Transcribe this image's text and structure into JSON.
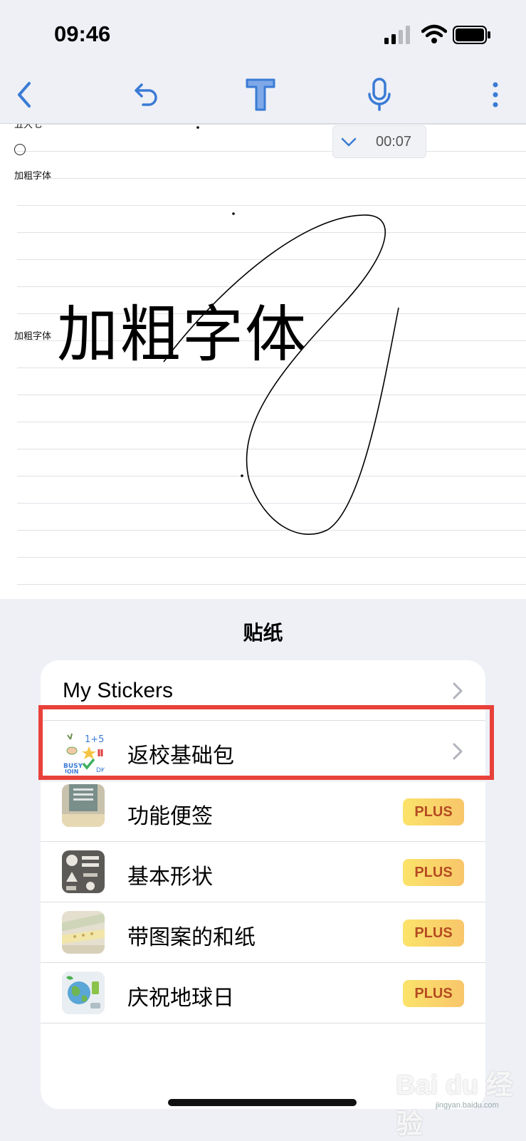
{
  "status_bar": {
    "time": "09:46"
  },
  "note": {
    "cut_top_text": "五大七",
    "small_label_1": "加粗字体",
    "small_label_2": "加粗字体",
    "big_text": "加粗字体",
    "recording_time": "00:07"
  },
  "sticker_sheet": {
    "title": "贴纸",
    "items": [
      {
        "label": "My Stickers",
        "icon": "chevron-right-icon"
      },
      {
        "label": "返校基础包",
        "icon": "chevron-right-icon",
        "thumbnail": "back-to-school-stickers-icon"
      },
      {
        "label": "功能便签",
        "badge": "PLUS",
        "thumbnail": "functional-notes-icon"
      },
      {
        "label": "基本形状",
        "badge": "PLUS",
        "thumbnail": "basic-shapes-icon"
      },
      {
        "label": "带图案的和纸",
        "badge": "PLUS",
        "thumbnail": "patterned-washi-icon"
      },
      {
        "label": "庆祝地球日",
        "badge": "PLUS",
        "thumbnail": "earth-day-icon"
      }
    ]
  },
  "watermark": {
    "text": "Bai du 经验",
    "sub": "jingyan.baidu.com"
  },
  "colors": {
    "accent": "#3a7bd5",
    "highlight": "#e8413a",
    "plus_text": "#b54b22"
  }
}
